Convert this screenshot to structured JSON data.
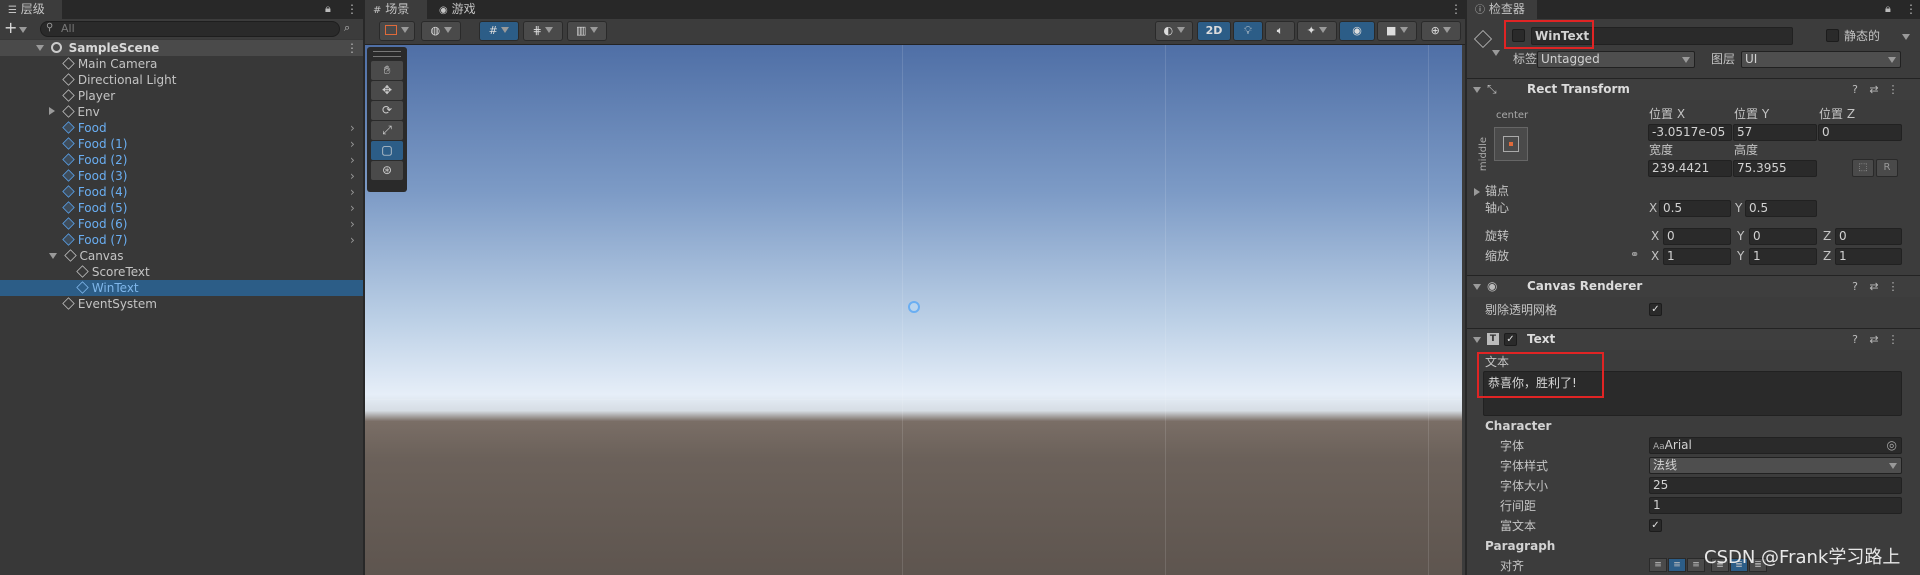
{
  "hierarchy": {
    "tab_label": "层级",
    "search_placeholder": "All",
    "add_label": "+",
    "scene_name": "SampleScene",
    "items": [
      {
        "label": "Main Camera"
      },
      {
        "label": "Directional Light"
      },
      {
        "label": "Player"
      },
      {
        "label": "Env"
      },
      {
        "label": "Food"
      },
      {
        "label": "Food (1)"
      },
      {
        "label": "Food (2)"
      },
      {
        "label": "Food (3)"
      },
      {
        "label": "Food (4)"
      },
      {
        "label": "Food (5)"
      },
      {
        "label": "Food (6)"
      },
      {
        "label": "Food (7)"
      },
      {
        "label": "Canvas"
      },
      {
        "label": "ScoreText"
      },
      {
        "label": "WinText"
      },
      {
        "label": "EventSystem"
      }
    ]
  },
  "scene": {
    "tab_scene": "场景",
    "tab_game": "游戏",
    "btn_2d": "2D"
  },
  "inspector": {
    "tab_label": "检查器",
    "object_name": "WinText",
    "static_label": "静态的",
    "tag_label": "标签",
    "tag_value": "Untagged",
    "layer_label": "图层",
    "layer_value": "UI",
    "rect_transform": {
      "title": "Rect Transform",
      "anchor_h": "center",
      "anchor_v": "middle",
      "pos_x_label": "位置 X",
      "pos_y_label": "位置 Y",
      "pos_z_label": "位置 Z",
      "pos_x": "-3.0517e-05",
      "pos_y": "57",
      "pos_z": "0",
      "width_label": "宽度",
      "height_label": "高度",
      "width": "239.4421",
      "height": "75.3955",
      "r_button": "R",
      "anchors_label": "锚点",
      "pivot_label": "轴心",
      "pivot_x": "0.5",
      "pivot_y": "0.5",
      "rotation_label": "旋转",
      "rot_x": "0",
      "rot_y": "0",
      "rot_z": "0",
      "scale_label": "缩放",
      "scale_x": "1",
      "scale_y": "1",
      "scale_z": "1",
      "x": "X",
      "y": "Y",
      "z": "Z"
    },
    "canvas_renderer": {
      "title": "Canvas Renderer",
      "cull_label": "剔除透明网格"
    },
    "text": {
      "title": "Text",
      "text_label": "文本",
      "text_value": "恭喜你，胜利了!",
      "character_label": "Character",
      "font_label": "字体",
      "font_value": "Arial",
      "font_style_label": "字体样式",
      "font_style_value": "法线",
      "font_size_label": "字体大小",
      "font_size_value": "25",
      "line_spacing_label": "行间距",
      "line_spacing_value": "1",
      "rich_text_label": "富文本",
      "paragraph_label": "Paragraph",
      "align_label": "对齐"
    }
  },
  "watermark": "CSDN @Frank学习路上"
}
